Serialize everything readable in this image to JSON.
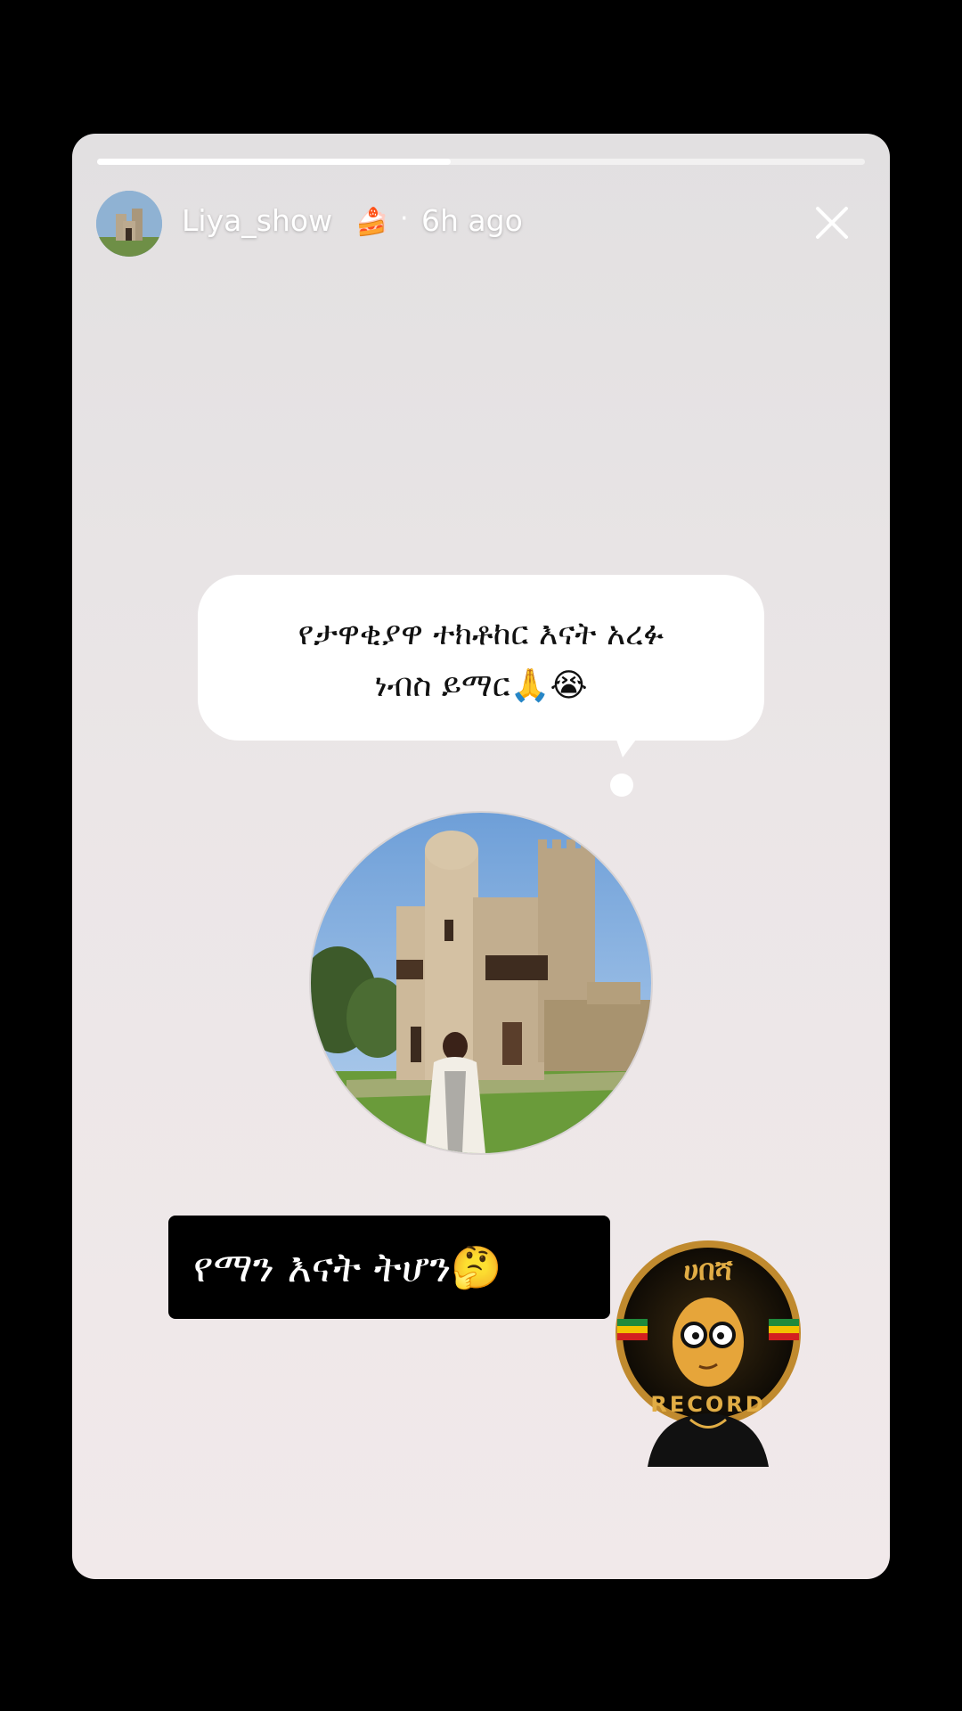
{
  "story": {
    "progress": 0.46,
    "user": {
      "username": "Liya_show",
      "emoji": "🍰",
      "separator": "·",
      "time": "6h ago"
    },
    "question_bubble": {
      "line1": "የታዋቂያዋ ተክቶከር እናት አረፉ",
      "line2": "ነብስ ይማር🙏😭"
    },
    "caption": "የማን እናት ትሆን🤔",
    "sticker_text": {
      "top": "ሀበሻ",
      "bottom": "RECORD"
    },
    "colors": {
      "bubble": "#ffffff",
      "caption_bg": "#000000",
      "sticker_ring": "#d8a43c"
    }
  }
}
